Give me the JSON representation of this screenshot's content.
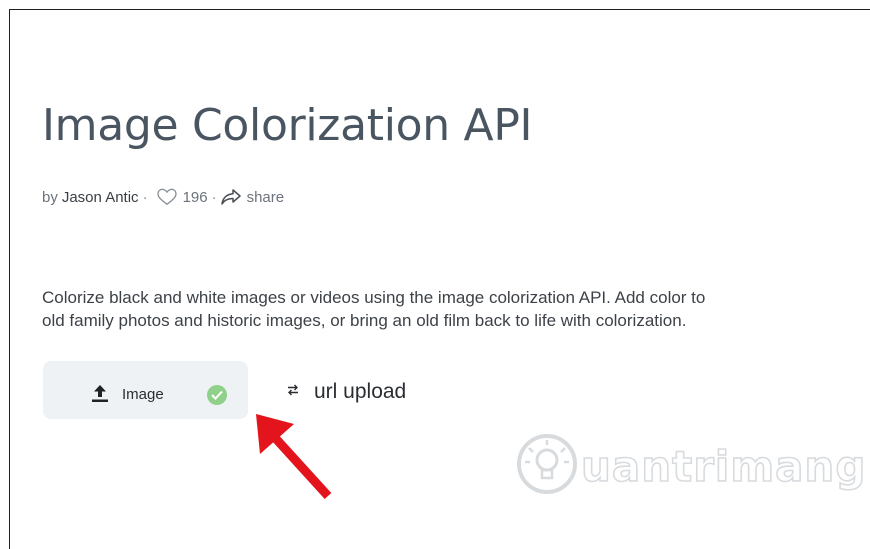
{
  "page": {
    "title": "Image Colorization API",
    "byline": {
      "prefix": "by",
      "author": "Jason Antic",
      "separator": "·",
      "likes": "196",
      "share_label": "share"
    },
    "description": [
      "Colorize black and white images or videos using the image colorization API. Add color to",
      "old family photos and historic images, or bring an old film back to life with colorization."
    ]
  },
  "upload": {
    "image_label": "Image",
    "url_label": "url upload",
    "selected_color": "#8fd18a"
  },
  "annotation": {
    "arrow_color": "#e3141c"
  },
  "watermark": {
    "text": "uantrimang"
  },
  "icons": {
    "like": "heart-outline-icon",
    "share": "share-arrow-icon",
    "upload": "upload-icon",
    "check": "check-circle-icon",
    "swap": "swap-arrows-icon"
  }
}
